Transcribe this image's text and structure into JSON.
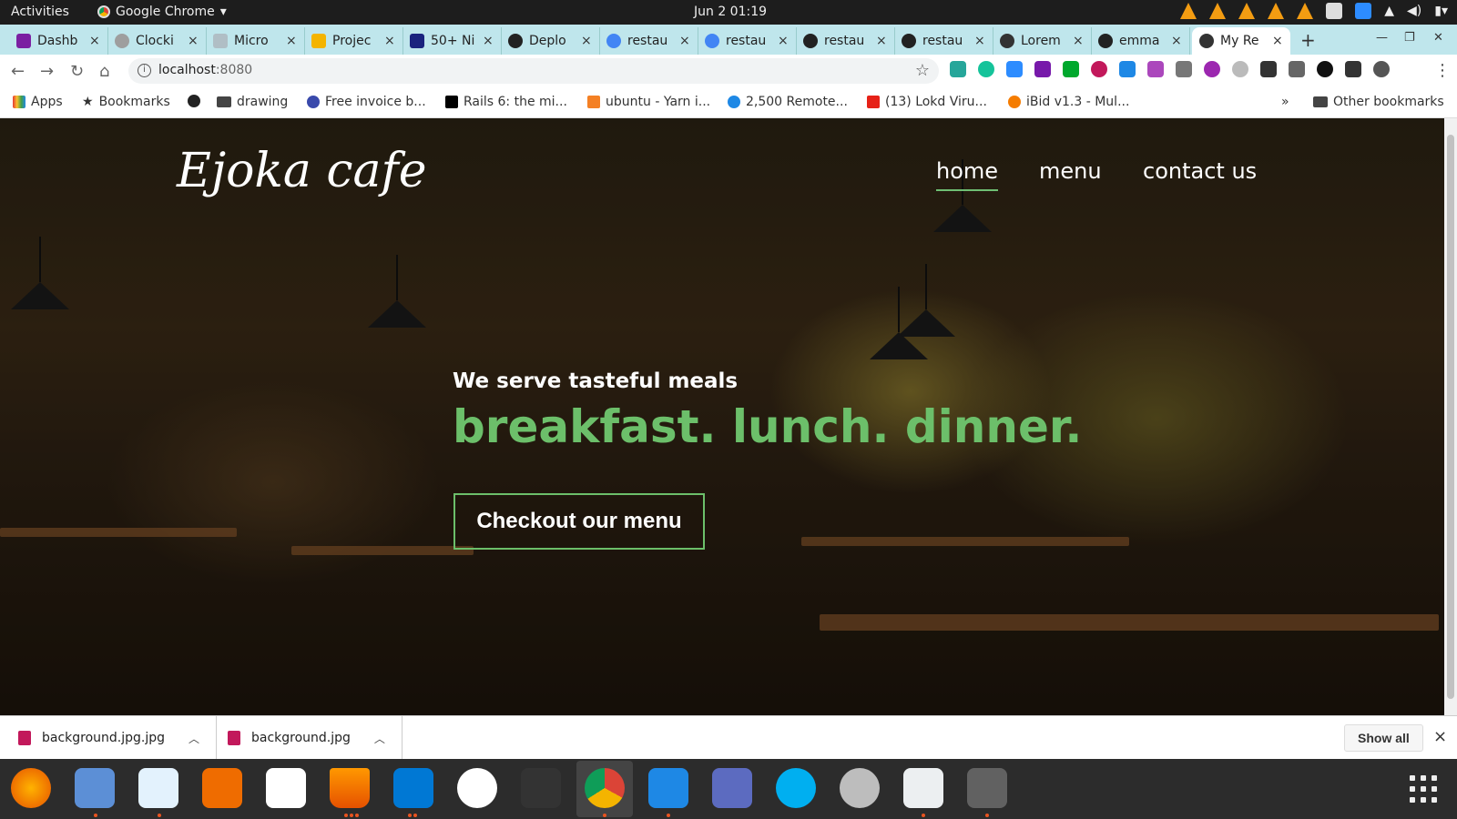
{
  "os": {
    "activities": "Activities",
    "app_name": "Google Chrome",
    "clock": "Jun 2  01:19"
  },
  "tabs": [
    {
      "title": "Dashb",
      "color": "#7b1fa2"
    },
    {
      "title": "Clocki",
      "color": "#9e9e9e"
    },
    {
      "title": "Micro",
      "color": "#b0bec5"
    },
    {
      "title": "Projec",
      "color": "#f4b400"
    },
    {
      "title": "50+ Ni",
      "color": "#1a237e"
    },
    {
      "title": "Deplo",
      "color": "#222222"
    },
    {
      "title": "restau",
      "color": "#4285f4"
    },
    {
      "title": "restau",
      "color": "#4285f4"
    },
    {
      "title": "restau",
      "color": "#222222"
    },
    {
      "title": "restau",
      "color": "#222222"
    },
    {
      "title": "Lorem",
      "color": "#333333"
    },
    {
      "title": "emma",
      "color": "#222222"
    },
    {
      "title": "My Re",
      "color": "#333333"
    }
  ],
  "tab_close": "×",
  "new_tab": "+",
  "address": {
    "host": "localhost",
    "port": ":8080"
  },
  "bookmarks": {
    "apps": "Apps",
    "bookmarks": "Bookmarks",
    "drawing": "drawing",
    "invoice": "Free invoice b...",
    "rails": "Rails 6: the mi...",
    "yarn": "ubuntu - Yarn i...",
    "remote": "2,500 Remote...",
    "youtube": "(13) Lokd Viru...",
    "ibid": "iBid v1.3 - Mul...",
    "more": "»",
    "other": "Other bookmarks"
  },
  "site": {
    "brand": "Ejoka cafe",
    "nav": [
      "home",
      "menu",
      "contact us"
    ],
    "tagline": "We serve tasteful meals",
    "headline": "breakfast. lunch. dinner.",
    "cta": "Checkout our menu",
    "accent_color": "#6cbf6a"
  },
  "downloads": {
    "items": [
      "background.jpg.jpg",
      "background.jpg"
    ],
    "show_all": "Show all",
    "close": "×"
  },
  "dock_apps": [
    "firefox",
    "files",
    "text-editor",
    "software",
    "amazon",
    "vlc",
    "vscode",
    "slack",
    "terminal",
    "chrome",
    "gedit",
    "screenshot",
    "skype",
    "app-12",
    "search-tool",
    "app-14"
  ]
}
